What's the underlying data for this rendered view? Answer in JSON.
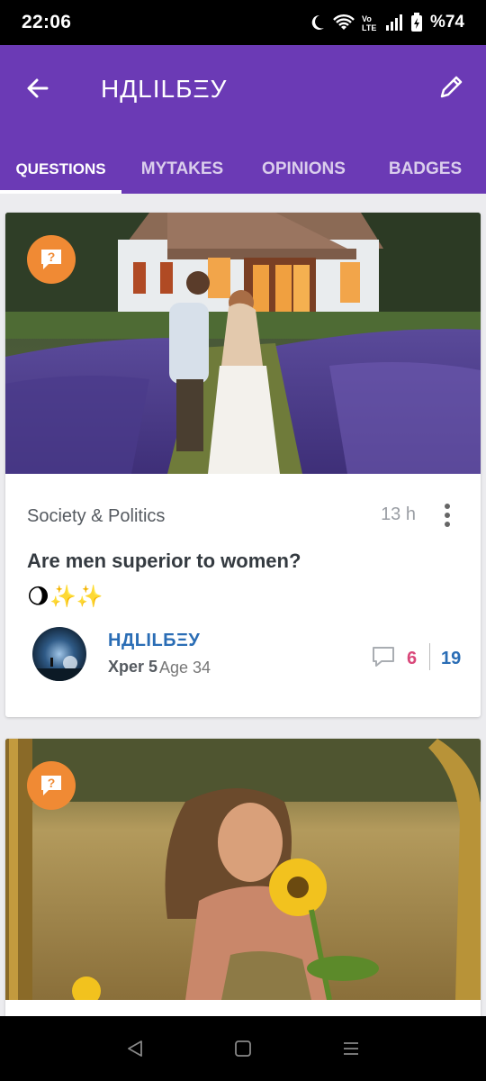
{
  "status_bar": {
    "time": "22:06",
    "battery": "%74",
    "icons": [
      "moon-icon",
      "wifi-icon",
      "volte-icon",
      "signal-icon",
      "battery-icon"
    ]
  },
  "app_bar": {
    "title": "НДLILБΞУ",
    "back_icon": "back-arrow-icon",
    "edit_icon": "pencil-icon",
    "background": "#6b3ab5"
  },
  "tabs": [
    {
      "label": "QUESTIONS",
      "active": true
    },
    {
      "label": "MYTAKES",
      "active": false
    },
    {
      "label": "OPINIONS",
      "active": false
    },
    {
      "label": "BADGES",
      "active": false
    }
  ],
  "posts": [
    {
      "type_icon": "question-badge-icon",
      "category": "Society & Politics",
      "time_ago": "13 h",
      "title": "Are men superior to women?",
      "emoji": "🌖✨✨",
      "author": {
        "name": "НДLILБΞУ",
        "level": "Xper 5",
        "age": "Age 34"
      },
      "comments": "6",
      "views": "19"
    },
    {
      "type_icon": "question-badge-icon"
    }
  ],
  "colors": {
    "accent": "#6b3ab5",
    "badge": "#f08a34",
    "author": "#2a6db5",
    "comments": "#d9487a"
  }
}
